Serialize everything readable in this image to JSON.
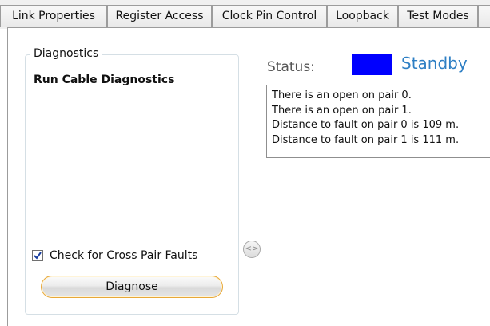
{
  "tabs": [
    {
      "label": "Link Properties"
    },
    {
      "label": "Register Access"
    },
    {
      "label": "Clock Pin Control"
    },
    {
      "label": "Loopback"
    },
    {
      "label": "Test Modes"
    }
  ],
  "diagnostics": {
    "group_title": "Diagnostics",
    "heading": "Run Cable Diagnostics",
    "cross_pair_checkbox": {
      "label": "Check for Cross Pair Faults",
      "checked": true
    },
    "diagnose_button": "Diagnose"
  },
  "splitter": {
    "icon": "splitter-arrows-icon",
    "glyph": "<>"
  },
  "status": {
    "label": "Status:",
    "value": "Standby",
    "indicator_color": "#0000ff"
  },
  "results": {
    "lines": [
      "There is an open on pair 0.",
      "There is an open on pair 1.",
      "Distance to fault on pair 0 is 109 m.",
      "Distance to fault on pair 1 is 111 m."
    ]
  }
}
